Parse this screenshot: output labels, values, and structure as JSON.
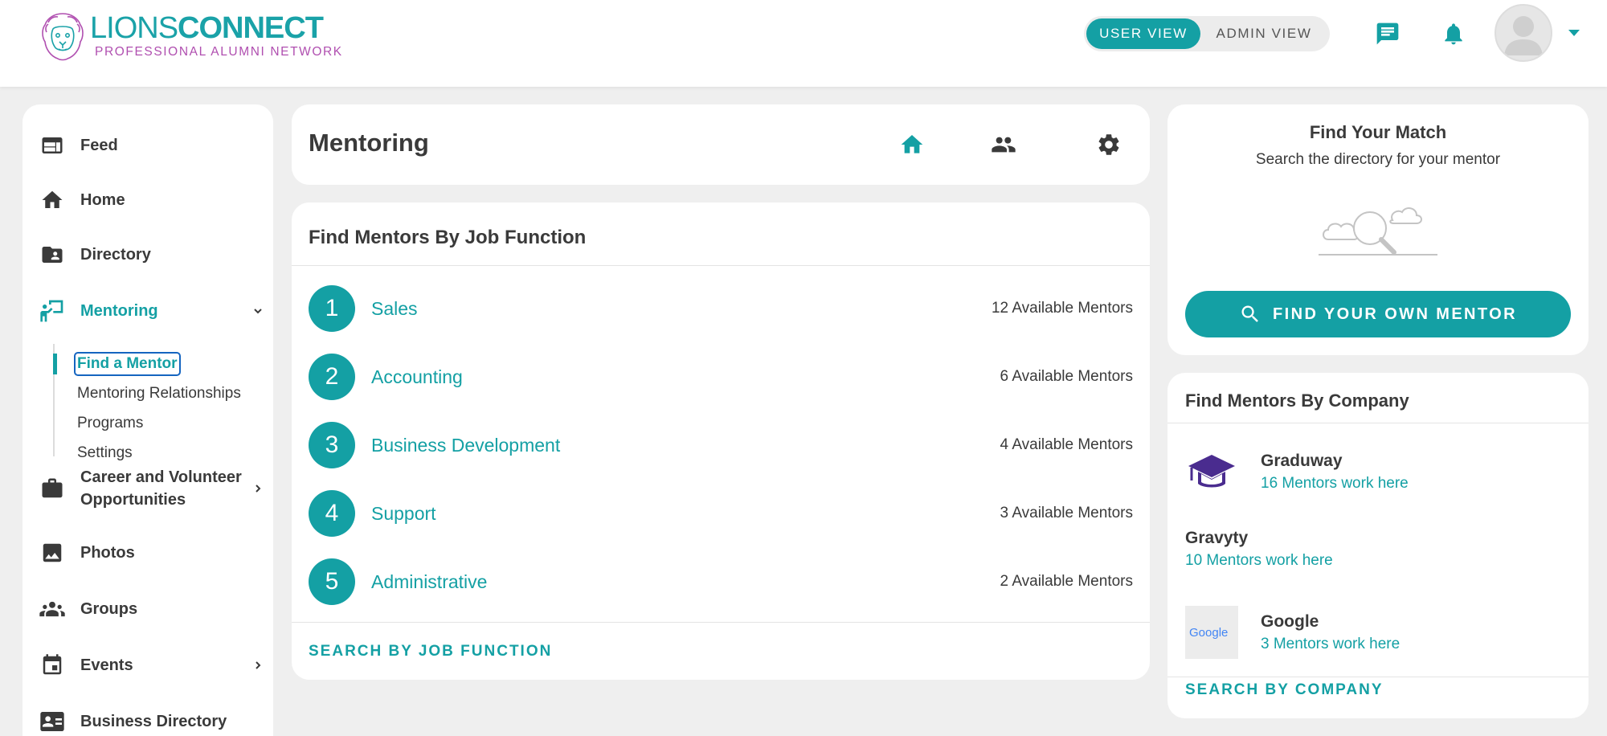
{
  "brand": {
    "name_part1": "LIONS",
    "name_part2": "CONNECT",
    "tagline": "PROFESSIONAL ALUMNI NETWORK"
  },
  "header": {
    "user_view": "USER VIEW",
    "admin_view": "ADMIN VIEW",
    "icons": [
      "chat-icon",
      "bell-icon",
      "avatar",
      "caret-down-icon"
    ]
  },
  "sidebar": {
    "items": [
      {
        "label": "Feed",
        "icon": "feed-icon"
      },
      {
        "label": "Home",
        "icon": "home-icon"
      },
      {
        "label": "Directory",
        "icon": "directory-icon"
      },
      {
        "label": "Mentoring",
        "icon": "mentoring-icon"
      },
      {
        "label": "Career and Volunteer Opportunities",
        "icon": "briefcase-icon"
      },
      {
        "label": "Photos",
        "icon": "photo-icon"
      },
      {
        "label": "Groups",
        "icon": "groups-icon"
      },
      {
        "label": "Events",
        "icon": "events-icon"
      },
      {
        "label": "Business Directory",
        "icon": "business-card-icon"
      }
    ],
    "sub_items": [
      {
        "label": "Find a Mentor"
      },
      {
        "label": "Mentoring Relationships"
      },
      {
        "label": "Programs"
      },
      {
        "label": "Settings"
      }
    ]
  },
  "mentoring": {
    "title": "Mentoring",
    "icons": [
      "home-icon",
      "people-icon",
      "gear-icon"
    ]
  },
  "job_functions": {
    "title": "Find Mentors By Job Function",
    "items": [
      {
        "num": "1",
        "name": "Sales",
        "count": "12 Available Mentors"
      },
      {
        "num": "2",
        "name": "Accounting",
        "count": "6 Available Mentors"
      },
      {
        "num": "3",
        "name": "Business Development",
        "count": "4 Available Mentors"
      },
      {
        "num": "4",
        "name": "Support",
        "count": "3 Available Mentors"
      },
      {
        "num": "5",
        "name": "Administrative",
        "count": "2 Available Mentors"
      }
    ],
    "link": "SEARCH BY JOB FUNCTION"
  },
  "find_match": {
    "title": "Find Your Match",
    "subtitle": "Search the directory for your mentor",
    "button": "FIND YOUR OWN MENTOR"
  },
  "companies": {
    "title": "Find Mentors By Company",
    "items": [
      {
        "name": "Graduway",
        "count": "16 Mentors work here",
        "logo": "graduation-cap-icon"
      },
      {
        "name": "Gravyty",
        "count": "10 Mentors work here"
      },
      {
        "name": "Google",
        "count": "3 Mentors work here",
        "logo_text": "Google"
      }
    ],
    "link": "SEARCH BY COMPANY"
  },
  "colors": {
    "accent": "#14a0a4",
    "brand_purple": "#b04fb0",
    "text": "#3a3a3a",
    "background": "#efefef"
  }
}
